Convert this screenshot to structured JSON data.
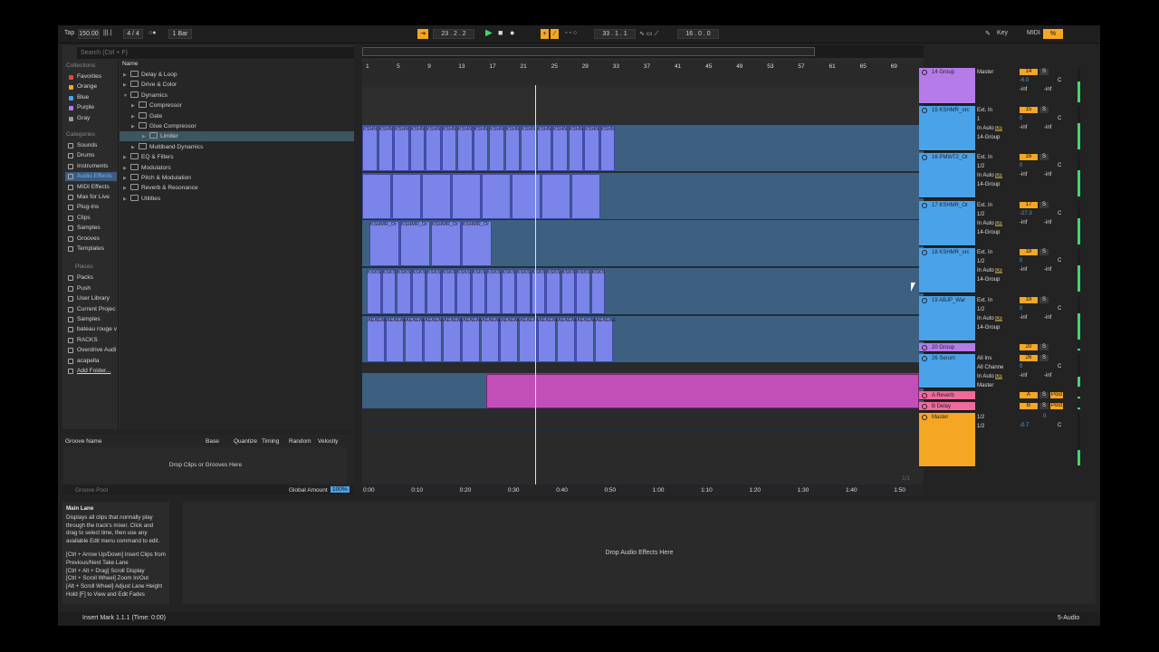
{
  "transport": {
    "tap": "Tap",
    "tempo": "150.00",
    "sig": "4 / 4",
    "quant": "1 Bar",
    "arr_pos": "23 . 2 . 2",
    "loop_start": "33 . 1 . 1",
    "loop_len": "16 . 0 . 0",
    "key": "Key",
    "midi": "MIDI",
    "cpu": "%"
  },
  "browser": {
    "search_placeholder": "Search (Ctrl + F)",
    "collections_label": "Collections",
    "collections": [
      {
        "label": "Favorites",
        "color": "#e5483b"
      },
      {
        "label": "Orange",
        "color": "#f5a623"
      },
      {
        "label": "Blue",
        "color": "#4aa3ff"
      },
      {
        "label": "Purple",
        "color": "#b57be8"
      },
      {
        "label": "Gray",
        "color": "#9a9a9a"
      }
    ],
    "categories_label": "Categories",
    "categories": [
      "Sounds",
      "Drums",
      "Instruments",
      "Audio Effects",
      "MIDI Effects",
      "Max for Live",
      "Plug-Ins",
      "Clips",
      "Samples",
      "Grooves",
      "Templates"
    ],
    "places_label": "Places",
    "places": [
      "Packs",
      "Push",
      "User Library",
      "Current Projec",
      "Samples",
      "bateau rouge v",
      "RACKS",
      "Overdrive Audi",
      "acapella",
      "Add Folder..."
    ],
    "name_header": "Name",
    "items": [
      {
        "label": "Delay & Loop",
        "lv": 0
      },
      {
        "label": "Drive & Color",
        "lv": 0
      },
      {
        "label": "Dynamics",
        "lv": 0
      },
      {
        "label": "Compressor",
        "lv": 1
      },
      {
        "label": "Gate",
        "lv": 1
      },
      {
        "label": "Glue Compressor",
        "lv": 1
      },
      {
        "label": "Limiter",
        "lv": 1
      },
      {
        "label": "Multiband Dynamics",
        "lv": 1
      },
      {
        "label": "EQ & Filters",
        "lv": 0
      },
      {
        "label": "Modulators",
        "lv": 0
      },
      {
        "label": "Pitch & Modulation",
        "lv": 0
      },
      {
        "label": "Reverb & Resonance",
        "lv": 0
      },
      {
        "label": "Utilities",
        "lv": 0
      }
    ]
  },
  "groove": {
    "col_name": "Groove Name",
    "col_base": "Base",
    "col_quantize": "Quantize",
    "col_timing": "Timing",
    "col_random": "Random",
    "col_velocity": "Velocity",
    "drop": "Drop Clips or Grooves Here",
    "pool": "Groove Pool",
    "global": "Global Amount",
    "global_val": "100%"
  },
  "info": {
    "title": "Main Lane",
    "body": "Displays all clips that normally play through the track's mixer. Click and drag to select time, then use any available Edit menu command to edit.",
    "lines": [
      "[Ctrl + Arrow Up/Down] Insert Clips from Previous/Next Take Lane",
      "[Ctrl + Alt + Drag] Scroll Display",
      "[Ctrl + Scroll Wheel] Zoom In/Out",
      "[Alt + Scroll Wheel] Adjust Lane Height",
      "Hold [F] to View and Edit Fades"
    ]
  },
  "fx_drop": "Drop Audio Effects Here",
  "status": {
    "text": "Insert Mark 1.1.1 (Time: 0:00)",
    "track": "5-Audio"
  },
  "ruler": {
    "bars": [
      "1",
      "5",
      "9",
      "13",
      "17",
      "21",
      "25",
      "29",
      "33",
      "37",
      "41",
      "45",
      "49",
      "53",
      "57",
      "61",
      "65",
      "69"
    ],
    "times": [
      "0:00",
      "0:10",
      "0:20",
      "0:30",
      "0:40",
      "0:50",
      "1:00",
      "1:10",
      "1:20",
      "1:30",
      "1:40",
      "1:50"
    ],
    "set": "Set",
    "page": "1/1"
  },
  "tracks": [
    {
      "name": "14 Group",
      "color": "#b57be8",
      "in": "",
      "route": "Master",
      "num": "14",
      "vol": "-6.0"
    },
    {
      "name": "15 KSHMR_orc",
      "color": "#4aa3e8",
      "in": "Ext. In",
      "ch": "1",
      "route": "14-Group",
      "num": "15",
      "vol": "0"
    },
    {
      "name": "16 PMWT2_Or",
      "color": "#4aa3e8",
      "in": "Ext. In",
      "ch": "1/2",
      "route": "14-Group",
      "num": "16",
      "vol": "0"
    },
    {
      "name": "17 KSHMR_Or",
      "color": "#4aa3e8",
      "in": "Ext. In",
      "ch": "1/2",
      "route": "14-Group",
      "num": "17",
      "vol": "-27.3"
    },
    {
      "name": "18 KSHMR_orc",
      "color": "#4aa3e8",
      "in": "Ext. In",
      "ch": "1/2",
      "route": "14-Group",
      "num": "18",
      "vol": "0"
    },
    {
      "name": "19 ABJP_War",
      "color": "#4aa3e8",
      "in": "Ext. In",
      "ch": "1/2",
      "route": "14-Group",
      "num": "19",
      "vol": "0"
    },
    {
      "name": "20 Group",
      "color": "#b57be8",
      "num": "20"
    },
    {
      "name": "26 Serum",
      "color": "#4aa3e8",
      "in": "All Ins",
      "ch": "All Channe",
      "route": "Master",
      "num": "26",
      "vol": "0"
    },
    {
      "name": "A Reverb",
      "color": "#f06a9a",
      "num": "A",
      "post": "Post"
    },
    {
      "name": "B Delay",
      "color": "#f06a9a",
      "num": "B",
      "post": "Post"
    },
    {
      "name": "Master",
      "color": "#f5a623",
      "ch": "1/2",
      "ch2": "1/2",
      "vol": "-0.7",
      "vol2": "0"
    }
  ],
  "mix_common": {
    "auto": "Auto",
    "off": "Off",
    "in": "In",
    "s": "S",
    "c": "C",
    "inf": "-inf"
  },
  "clips": {
    "k15": "KSHN",
    "k17": "KSHMR_Or",
    "k18": "KSKS",
    "k19": "AEAEAE"
  }
}
